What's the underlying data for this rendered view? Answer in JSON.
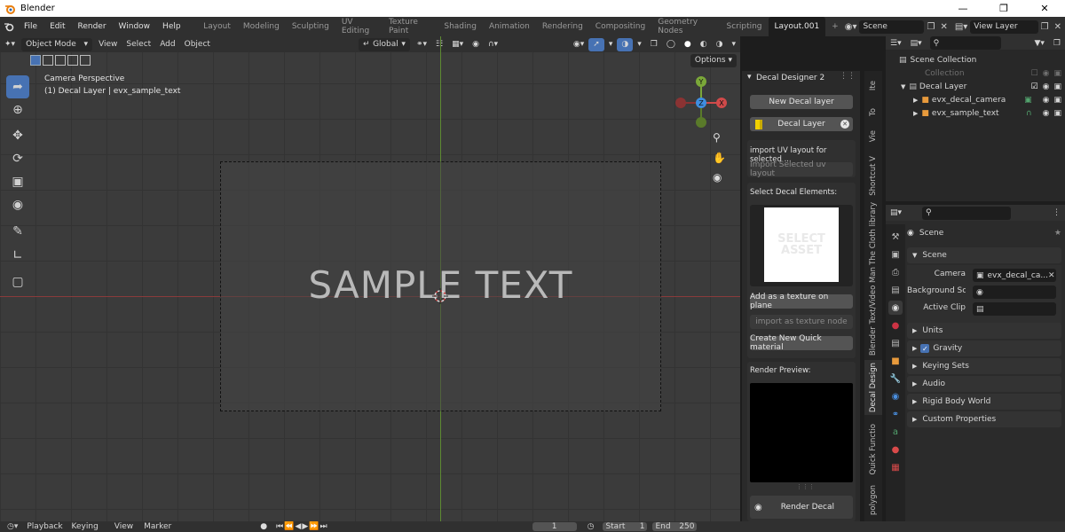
{
  "app": {
    "title": "Blender"
  },
  "menu": {
    "items": [
      "File",
      "Edit",
      "Render",
      "Window",
      "Help"
    ]
  },
  "workspaces": [
    "Layout",
    "Modeling",
    "Sculpting",
    "UV Editing",
    "Texture Paint",
    "Shading",
    "Animation",
    "Rendering",
    "Compositing",
    "Geometry Nodes",
    "Scripting",
    "Layout.001"
  ],
  "add_tab": "+",
  "scene_field": "Scene",
  "view_layer_field": "View Layer",
  "viewport": {
    "mode": "Object Mode",
    "menus": [
      "View",
      "Select",
      "Add",
      "Object"
    ],
    "transform_orientation": "Global",
    "options_label": "Options",
    "overlay_line1": "Camera Perspective",
    "overlay_line2": "(1) Decal Layer | evx_sample_text",
    "sample_text": "SAMPLE TEXT",
    "gizmo": {
      "y": "Y",
      "z": "Z",
      "x": "X"
    }
  },
  "npanel": {
    "title": "Decal Designer 2",
    "new_layer": "New Decal layer",
    "layer_name": "Decal Layer",
    "import_uv_label": "import UV layout for selected ...",
    "import_uv_button": "Import Selected uv layout",
    "select_elements": "Select Decal Elements:",
    "asset_placeholder": "SELECT ASSET",
    "add_texture_plane": "Add as a texture on plane",
    "import_texture_node": "import as texture node",
    "create_quick_material": "Create New Quick material",
    "render_preview": "Render Preview:",
    "render_decal": "Render Decal"
  },
  "vtabs": [
    "Ite",
    "To",
    "Vie",
    "Shortcut V",
    "The Cloth library",
    "Blender Text/Video Man",
    "Decal Design",
    "Quick Functio",
    "polygon"
  ],
  "outliner": {
    "scene_collection": "Scene Collection",
    "collection": "Collection",
    "decal_layer": "Decal Layer",
    "camera_obj": "evx_decal_camera",
    "text_obj": "evx_sample_text"
  },
  "properties": {
    "header": "Scene",
    "section_scene": "Scene",
    "camera_label": "Camera",
    "camera_value": "evx_decal_ca...",
    "background_label": "Background Sc...",
    "active_clip_label": "Active Clip",
    "sections": [
      "Units",
      "Gravity",
      "Keying Sets",
      "Audio",
      "Rigid Body World",
      "Custom Properties"
    ]
  },
  "timeline": {
    "menus": [
      "Playback",
      "Keying",
      "View",
      "Marker"
    ],
    "current_frame": "1",
    "start_label": "Start",
    "start_value": "1",
    "end_label": "End",
    "end_value": "250"
  },
  "colors": {
    "accent": "#4772b3",
    "x_axis": "#d04a4a",
    "y_axis": "#7ba839",
    "z_axis": "#3f8ee0"
  }
}
